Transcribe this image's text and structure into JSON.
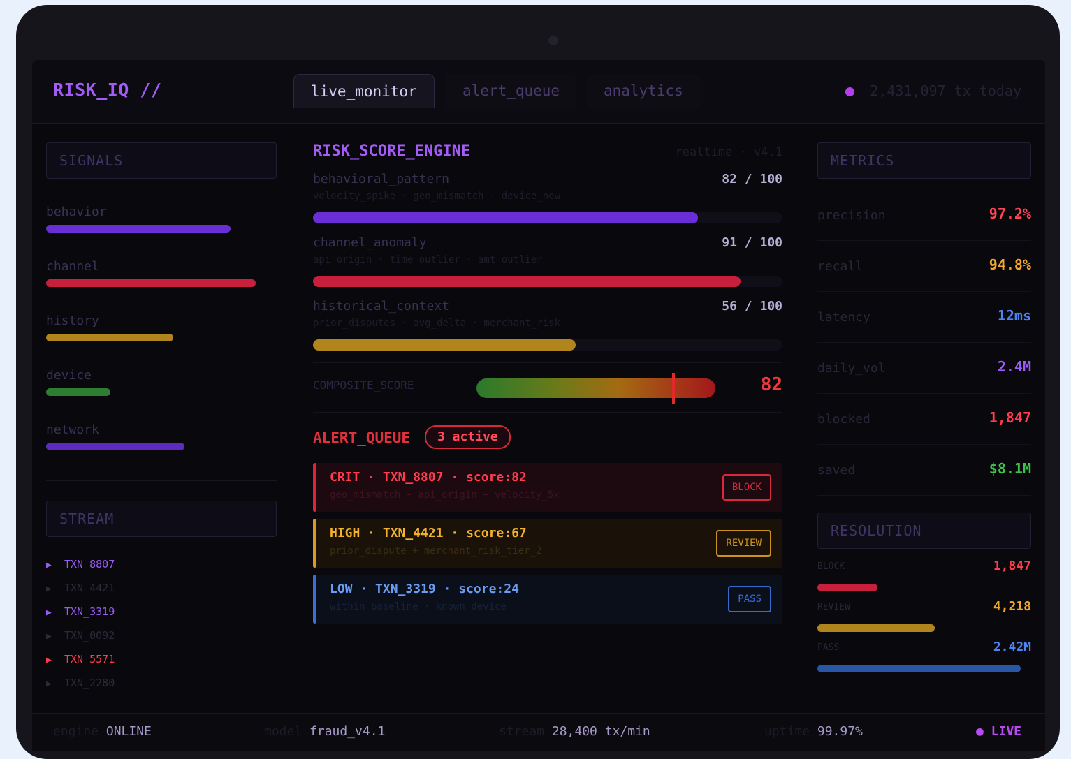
{
  "app": {
    "logo": "RISK_IQ //"
  },
  "tabs": [
    {
      "label": "live_monitor",
      "active": true
    },
    {
      "label": "alert_queue",
      "active": false
    },
    {
      "label": "analytics",
      "active": false
    }
  ],
  "header": {
    "tx_today": "2,431,097 tx today"
  },
  "signals": {
    "title": "SIGNALS",
    "items": [
      {
        "label": "behavior",
        "level": 0.8,
        "color": "#6a2ed6"
      },
      {
        "label": "channel",
        "level": 0.91,
        "color": "#c8203c"
      },
      {
        "label": "history",
        "level": 0.55,
        "color": "#b0861c"
      },
      {
        "label": "device",
        "level": 0.28,
        "color": "#2d7d32"
      },
      {
        "label": "network",
        "level": 0.6,
        "color": "#5e2bc0"
      }
    ]
  },
  "stream": {
    "title": "STREAM",
    "items": [
      {
        "label": "TXN_8807",
        "color": "#9b5cf6"
      },
      {
        "label": "TXN_4421",
        "color": "#2e2a3c"
      },
      {
        "label": "TXN_3319",
        "color": "#9b5cf6"
      },
      {
        "label": "TXN_0092",
        "color": "#2e2a3c"
      },
      {
        "label": "TXN_5571",
        "color": "#ff3c4c"
      },
      {
        "label": "TXN_2280",
        "color": "#2e2a3c"
      }
    ]
  },
  "engine": {
    "title": "RISK_SCORE_ENGINE",
    "tag": "realtime · v4.1",
    "factors": [
      {
        "name": "behavioral_pattern",
        "score": "82 / 100",
        "value": 82,
        "sub": "velocity_spike · geo_mismatch · device_new",
        "color": "#6a2ed6"
      },
      {
        "name": "channel_anomaly",
        "score": "91 / 100",
        "value": 91,
        "sub": "api_origin · time_outlier · amt_outlier",
        "color": "#c8203c"
      },
      {
        "name": "historical_context",
        "score": "56 / 100",
        "value": 56,
        "sub": "prior_disputes · avg_delta · merchant_risk",
        "color": "#b0861c"
      }
    ],
    "composite": {
      "label": "COMPOSITE_SCORE",
      "value": "82",
      "level": 0.82
    }
  },
  "alerts": {
    "title": "ALERT_QUEUE",
    "badge": "3 active",
    "items": [
      {
        "line": "CRIT · TXN_8807 · score:82",
        "sub": "geo_mismatch + api_origin + velocity_5x",
        "action": "BLOCK",
        "accent": "#e0233a",
        "bg": "#1c0a10",
        "text": "#ff3c4c",
        "subc": "#3d1420",
        "btn": "#d8283c"
      },
      {
        "line": "HIGH · TXN_4421 · score:67",
        "sub": "prior_dispute + merchant_risk_tier_2",
        "action": "REVIEW",
        "accent": "#d89a20",
        "bg": "#1a1208",
        "text": "#f2b22c",
        "subc": "#3a2c12",
        "btn": "#c8921c"
      },
      {
        "line": "LOW · TXN_3319 · score:24",
        "sub": "within_baseline · known_device",
        "action": "PASS",
        "accent": "#3b6ed6",
        "bg": "#0a0f1a",
        "text": "#6a9cf2",
        "subc": "#182238",
        "btn": "#3a6ad0"
      }
    ]
  },
  "metrics": {
    "title": "METRICS",
    "items": [
      {
        "name": "precision",
        "value": "97.2%",
        "color": "#ff4452"
      },
      {
        "name": "recall",
        "value": "94.8%",
        "color": "#f2a72c"
      },
      {
        "name": "latency",
        "value": "12ms",
        "color": "#4d84f2"
      },
      {
        "name": "daily_vol",
        "value": "2.4M",
        "color": "#9b5cf6"
      },
      {
        "name": "blocked",
        "value": "1,847",
        "color": "#ff3c4c"
      },
      {
        "name": "saved",
        "value": "$8.1M",
        "color": "#3ec24a"
      }
    ]
  },
  "resolution": {
    "title": "RESOLUTION",
    "items": [
      {
        "name": "BLOCK",
        "value": "1,847",
        "level": 0.28,
        "color": "#c8203c",
        "textcolor": "#ff3c4c"
      },
      {
        "name": "REVIEW",
        "value": "4,218",
        "level": 0.55,
        "color": "#b0861c",
        "textcolor": "#f2a72c"
      },
      {
        "name": "PASS",
        "value": "2.42M",
        "level": 0.95,
        "color": "#2a56a8",
        "textcolor": "#4d84f2"
      }
    ]
  },
  "footer": {
    "engine_key": "engine",
    "engine_val": "ONLINE",
    "model_key": "model",
    "model_val": "fraud_v4.1",
    "stream_key": "stream",
    "stream_val": "28,400 tx/min",
    "uptime_key": "uptime",
    "uptime_val": "99.97%",
    "live": "● LIVE"
  }
}
